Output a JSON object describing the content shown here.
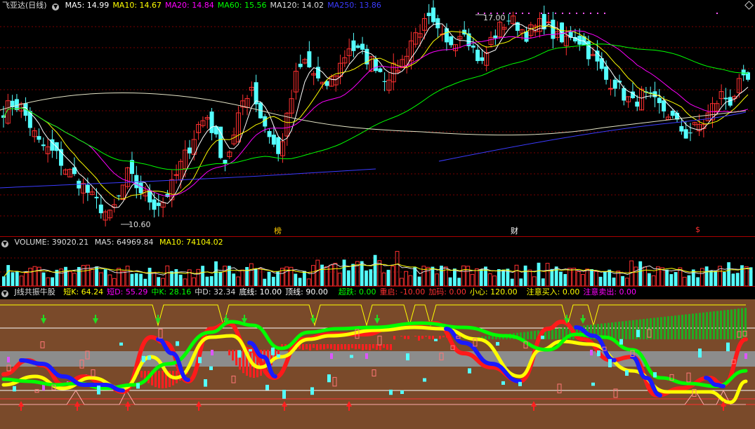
{
  "main_panel": {
    "title": "飞亚达(日线)",
    "ma_labels": [
      {
        "name": "MA5",
        "value": "14.99",
        "color": "#ffffff"
      },
      {
        "name": "MA10",
        "value": "14.67",
        "color": "#ffff00"
      },
      {
        "name": "MA20",
        "value": "14.84",
        "color": "#ff00ff"
      },
      {
        "name": "MA60",
        "value": "15.56",
        "color": "#00ff00"
      },
      {
        "name": "MA120",
        "value": "14.02",
        "color": "#dddddd"
      },
      {
        "name": "MA250",
        "value": "13.86",
        "color": "#3b3bff"
      }
    ],
    "high_label": "17.00",
    "low_label": "10.60",
    "event_markers": [
      {
        "text": "榜",
        "color": "#ffcc00"
      },
      {
        "text": "财",
        "color": "#ffffff"
      },
      {
        "text": "$",
        "color": "#ff3030"
      }
    ]
  },
  "volume_panel": {
    "label_volume": "VOLUME: 39020.21",
    "label_ma5": "MA5: 64969.84",
    "label_ma10": "MA10: 74104.02"
  },
  "indicator_panel": {
    "name": "J线共振牛股",
    "items": [
      {
        "text": "短K: 64.24",
        "color": "#ffff00"
      },
      {
        "text": "短D: 55.29",
        "color": "#ff00ff"
      },
      {
        "text": "中K: 28.16",
        "color": "#00ff00"
      },
      {
        "text": "中D: 32.34",
        "color": "#dddddd"
      },
      {
        "text": "底线: 10.00",
        "color": "#ffffff"
      },
      {
        "text": "顶线: 90.00",
        "color": "#ffffff"
      },
      {
        "text": "超跌: 0.00",
        "color": "#00ff00"
      },
      {
        "text": "重启: -10.00",
        "color": "#ff3030"
      },
      {
        "text": "加码: 0.00",
        "color": "#ff3030"
      },
      {
        "text": "小心: 120.00",
        "color": "#ffff00"
      },
      {
        "text": "注意买入: 0.00",
        "color": "#ffff00"
      },
      {
        "text": "注意卖出: 0.00",
        "color": "#ff00ff"
      }
    ]
  },
  "colors": {
    "up": "#ff3030",
    "down": "#54ffff",
    "grid": "#7a0000",
    "separator": "#a00000"
  },
  "chart_data": {
    "type": "candlestick",
    "price_range": [
      10.3,
      17.4
    ],
    "candles_approx_count": 85,
    "close_path": [
      14.1,
      14.3,
      14.2,
      13.6,
      13.0,
      12.8,
      12.6,
      12.2,
      11.9,
      11.6,
      11.2,
      10.9,
      10.6,
      11.2,
      12.0,
      11.6,
      11.3,
      11.0,
      11.1,
      11.6,
      12.3,
      12.9,
      13.6,
      13.9,
      13.1,
      12.4,
      13.2,
      14.4,
      14.9,
      13.9,
      13.3,
      12.6,
      13.8,
      15.2,
      15.7,
      15.3,
      14.8,
      15.1,
      15.6,
      16.2,
      16.0,
      15.8,
      15.6,
      15.2,
      15.4,
      15.7,
      16.4,
      16.8,
      17.0,
      16.6,
      16.2,
      16.5,
      16.8,
      16.1,
      15.6,
      16.4,
      16.8,
      17.1,
      16.9,
      16.6,
      16.8,
      17.0,
      16.6,
      16.3,
      16.6,
      16.4,
      16.0,
      15.6,
      15.1,
      15.0,
      14.6,
      14.3,
      14.6,
      14.4,
      14.2,
      14.0,
      13.6,
      13.3,
      13.5,
      13.7,
      14.2,
      14.6,
      14.4,
      14.9,
      15.1
    ]
  }
}
